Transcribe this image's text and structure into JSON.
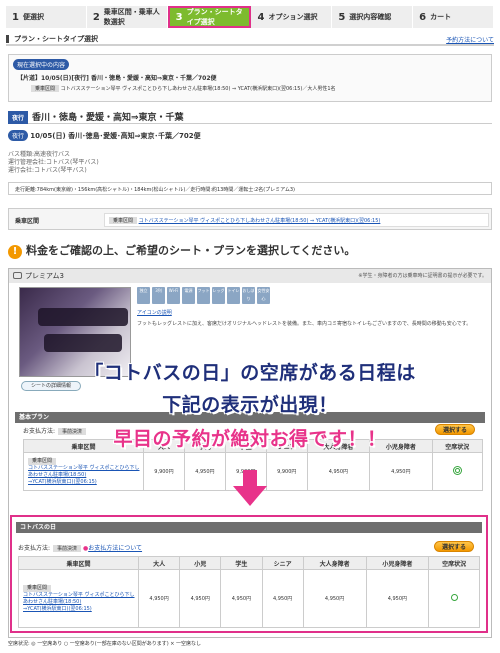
{
  "steps": [
    {
      "num": "1",
      "label": "便選択"
    },
    {
      "num": "2",
      "label": "乗車区間・乗車人数選択"
    },
    {
      "num": "3",
      "label": "プラン・シートタイプ選択"
    },
    {
      "num": "4",
      "label": "オプション選択"
    },
    {
      "num": "5",
      "label": "選択内容確認"
    },
    {
      "num": "6",
      "label": "カート"
    }
  ],
  "section_title": "プラン・シートタイプ選択",
  "help_link": "予約方法について",
  "current": {
    "badge": "現在選択中の内容",
    "summary": "【片道】10/05(日)[夜行] 香川・徳島・愛媛・高知⇒東京・千葉／702便",
    "stop_chip": "乗車区間",
    "stop_text": "コトバスステーション琴平 ヴィスポことひら下しあわせさん駐車場(18:50) ⇒ YCAT(横浜駅東口)(翌06:15)／大人男性1名"
  },
  "route_tag": "夜行",
  "route_title": "香川・徳島・愛媛・高知⇒東京・千葉",
  "trip_tag": "夜行",
  "trip_line": "10/05(日) 香川･徳島･愛媛･高知⇒東京･千葉／702便",
  "info": [
    "バス種類:高速夜行バス",
    "運行管理会社:コトバス(琴平バス)",
    "運行会社:コトバス(琴平バス)"
  ],
  "distance": "走行距離:784km(東京線)・156km(高松シャトル)・184km(松山シャトル)／走行時間:約13時間／運転士:2名(プレミアム3)",
  "segment_label": "乗車区間",
  "segment_chip": "乗車区間",
  "segment_text": "コトバスステーション琴平 ヴィスポことひら下しあわせさん駐車場(18:50) ⇒ YCAT(横浜駅東口)(翌06:15)",
  "notice": "料金をご確認の上、ご希望のシート・プランを選択してください。",
  "plan_name": "プレミアム3",
  "plan_note": "※学生・身障者の方は乗車時に証明書の提示が必要です。",
  "amenities": [
    "独立",
    "3列",
    "Wi-Fi",
    "電源",
    "フット",
    "レッグ",
    "トイレ",
    "おしぼり",
    "女性安心"
  ],
  "icon_link": "アイコンの説明",
  "plan_desc": "フットもレッグレストに加え、客席だけオリジナルヘッドレストを装備。また、車内コミ寄宿なトイレもございますので、長時間の移動も安心です。",
  "seat_detail_btn": "シートの詳細情報",
  "banner_line1": "「コトバスの日」の空席がある日程は",
  "banner_line2": "下記の表示が出現！",
  "banner_line3": "早目の予約が絶対お得です！！",
  "plans": [
    {
      "name": "基本プラン",
      "pay_label": "お支払方法:",
      "pay_chip": "事前決済",
      "pay_link": "",
      "select": "選択する",
      "prices": [
        "9,900円",
        "4,950円",
        "9,900円",
        "9,900円",
        "4,950円",
        "4,950円"
      ],
      "status": "double"
    },
    {
      "name": "コトバスの日",
      "pay_label": "お支払方法:",
      "pay_chip": "事前決済",
      "pay_link": "お支払方法について",
      "select": "選択する",
      "prices": [
        "4,950円",
        "4,950円",
        "4,950円",
        "4,950円",
        "4,950円",
        "4,950円"
      ],
      "status": "single"
    }
  ],
  "table_headers": [
    "乗車区間",
    "大人",
    "小児",
    "学生",
    "シニア",
    "大人身障者",
    "小児身障者",
    "空席状況"
  ],
  "route_cell": {
    "chip": "乗車区間",
    "text1": "コトバスステーション琴平 ヴィスポことひら下しあわせさん駐車場(18:50)",
    "text2": "⇒YCAT(横浜駅東口)(翌06:15)"
  },
  "legend": "空席状況: ◎ 一空席あり ○ 一空席あり(一部在庫のない区間があります) × 一空席なし"
}
